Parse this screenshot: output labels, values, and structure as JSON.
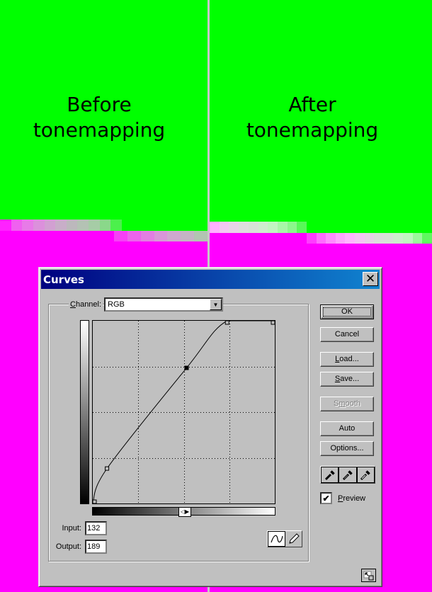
{
  "background": {
    "top_color": "#00ff00",
    "bottom_color": "#ff00ff",
    "divider_color": "#c8c8c8"
  },
  "panels": {
    "left": {
      "label_line1": "Before",
      "label_line2": "tonemapping",
      "strip1_colors": [
        "#ff22ff",
        "#f060f0",
        "#e87ae8",
        "#dc90dc",
        "#d2a0d2",
        "#c8aec8",
        "#bcb8bc",
        "#b4c2b4",
        "#a6cca6",
        "#8ad88a",
        "#4cf04c"
      ],
      "strip2_colors": [
        "#f640f6",
        "#ec64ec",
        "#e27ee2",
        "#d896d8",
        "#cea8ce",
        "#c4b4c4",
        "#b2c4b2"
      ]
    },
    "right": {
      "label_line1": "After",
      "label_line2": "tonemapping",
      "strip1_colors": [
        "#ffb0ff",
        "#f2c8f2",
        "#e8d4e8",
        "#dedede",
        "#d8e2d8",
        "#d0ecd0",
        "#c2f4c2",
        "#a8f6a8",
        "#8cf68c",
        "#58f858"
      ],
      "strip2_colors": [
        "#ff3cff",
        "#ff6cff",
        "#ff8cff",
        "#ffa4ff",
        "#ffb4ff",
        "#f4c4f4",
        "#e8d0e8",
        "#dcdcdc",
        "#d6e2d6",
        "#cceecc",
        "#c0f6c0",
        "#9cf89c",
        "#60f860"
      ]
    }
  },
  "dialog": {
    "title": "Curves",
    "close_glyph": "✕",
    "channel": {
      "label_prefix": "C",
      "label_rest": "hannel:",
      "value": "RGB",
      "arrow_glyph": "▼"
    },
    "curve": {
      "input_range": [
        0,
        255
      ],
      "output_range": [
        0,
        255
      ],
      "grid_divisions": 4,
      "control_points": [
        {
          "input": 0,
          "output": 0
        },
        {
          "input": 20,
          "output": 48
        },
        {
          "input": 132,
          "output": 189
        },
        {
          "input": 189,
          "output": 255
        },
        {
          "input": 255,
          "output": 255
        }
      ],
      "selected_point_index": 2
    },
    "input_label": "Input:",
    "input_value": "132",
    "output_label": "Output:",
    "output_value": "189",
    "buttons": {
      "ok": "OK",
      "cancel": "Cancel",
      "load_u": "L",
      "load_rest": "oad...",
      "save_u": "S",
      "save_rest": "ave...",
      "smooth_pre": "S",
      "smooth_u": "m",
      "smooth_rest": "ooth",
      "auto": "Auto",
      "options": "Options..."
    },
    "preview": {
      "label_u": "P",
      "label_rest": "review",
      "checked": true,
      "check_glyph": "✔"
    },
    "tools": [
      "curve-tool",
      "pencil-tool"
    ],
    "eyedroppers": [
      "black-point-eyedropper",
      "gray-point-eyedropper",
      "white-point-eyedropper"
    ]
  }
}
